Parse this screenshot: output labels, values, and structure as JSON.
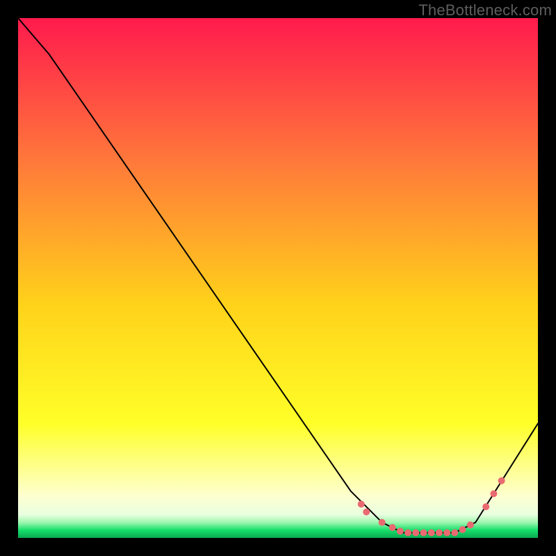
{
  "watermark": "TheBottleneck.com",
  "colors": {
    "black": "#000000",
    "grad_top": "#ff1a4d",
    "grad_mid1": "#ff7a3a",
    "grad_mid2": "#ffd21a",
    "grad_mid3": "#ffff28",
    "grad_pale": "#fdffd0",
    "grad_green": "#16e06b",
    "line": "#000000",
    "marker": "#ea6a71"
  },
  "chart_data": {
    "type": "line",
    "title": "",
    "xlabel": "",
    "ylabel": "",
    "xlim": [
      0,
      100
    ],
    "ylim": [
      0,
      100
    ],
    "curve": [
      {
        "x": 0,
        "y": 100
      },
      {
        "x": 6,
        "y": 93
      },
      {
        "x": 64,
        "y": 9
      },
      {
        "x": 70,
        "y": 3
      },
      {
        "x": 74,
        "y": 1
      },
      {
        "x": 84,
        "y": 1
      },
      {
        "x": 88,
        "y": 3
      },
      {
        "x": 100,
        "y": 22
      }
    ],
    "markers": [
      {
        "x": 66,
        "y": 6.5
      },
      {
        "x": 67,
        "y": 5
      },
      {
        "x": 70,
        "y": 3
      },
      {
        "x": 72,
        "y": 2
      },
      {
        "x": 73.5,
        "y": 1.3
      },
      {
        "x": 75,
        "y": 1
      },
      {
        "x": 76.5,
        "y": 1
      },
      {
        "x": 78,
        "y": 1
      },
      {
        "x": 79.5,
        "y": 1
      },
      {
        "x": 81,
        "y": 1
      },
      {
        "x": 82.5,
        "y": 1
      },
      {
        "x": 84,
        "y": 1
      },
      {
        "x": 85.5,
        "y": 1.6
      },
      {
        "x": 87,
        "y": 2.5
      },
      {
        "x": 90,
        "y": 6
      },
      {
        "x": 91.5,
        "y": 8.5
      },
      {
        "x": 93,
        "y": 11
      }
    ]
  }
}
